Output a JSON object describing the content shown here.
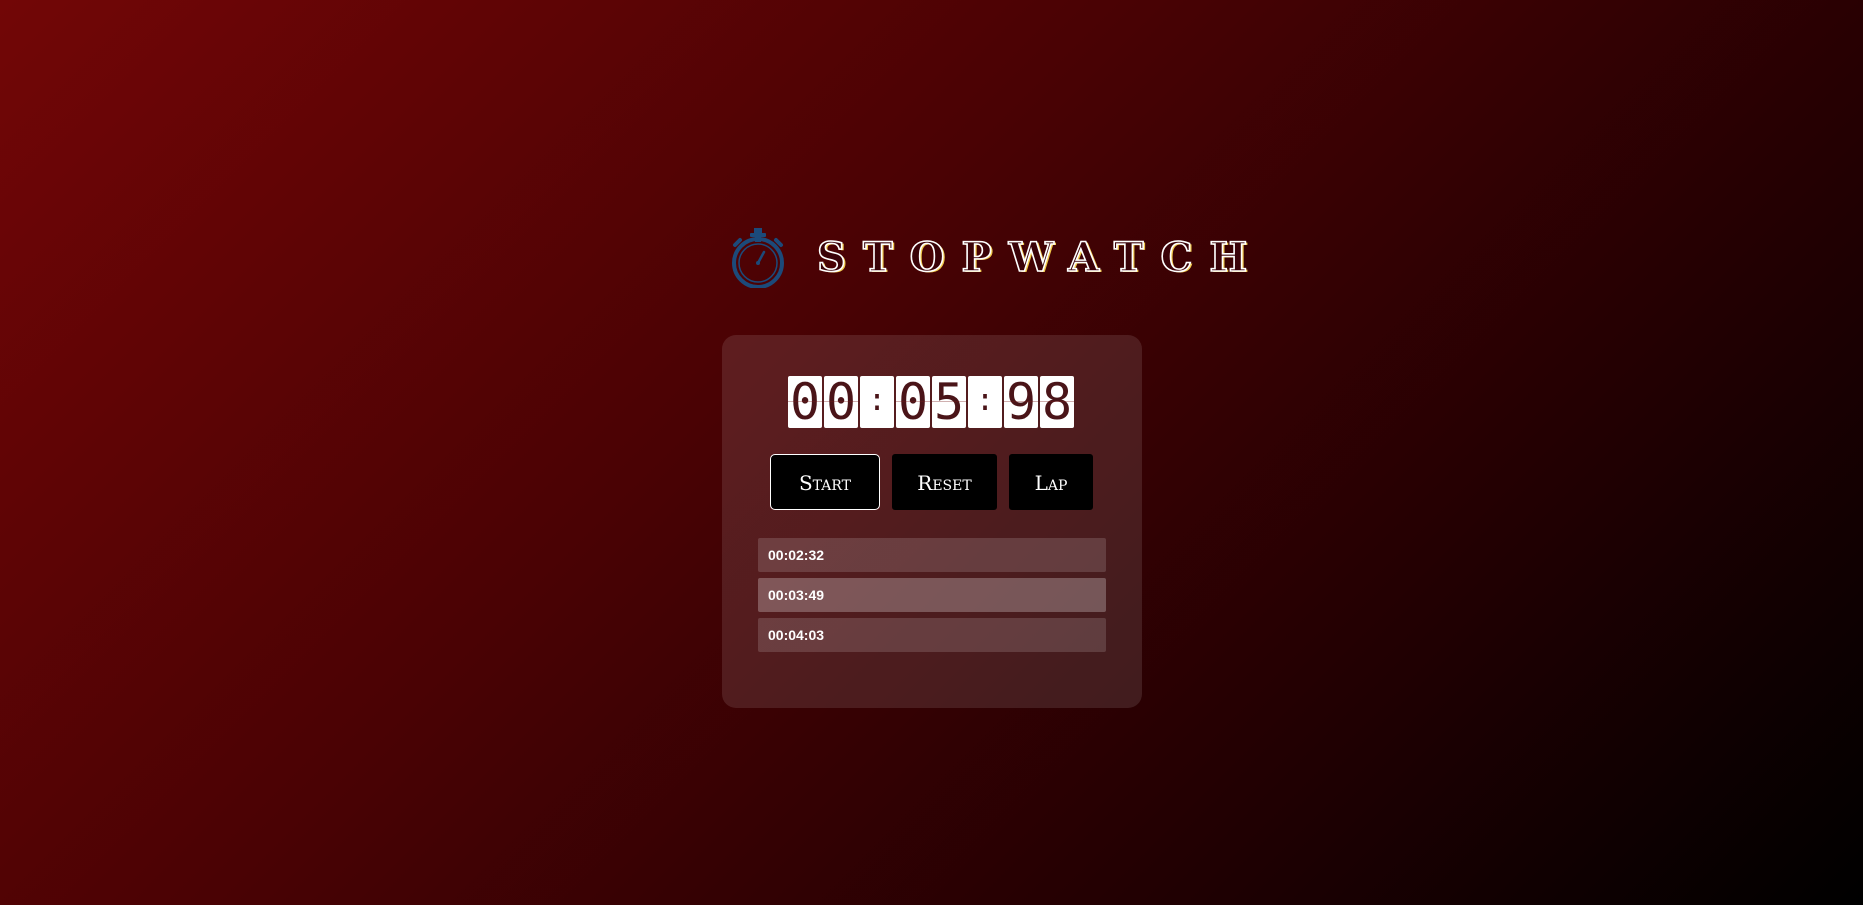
{
  "header": {
    "title": "STOPWATCH",
    "icon": "stopwatch-icon",
    "icon_color": "#1c4a7a"
  },
  "display": {
    "minutes": [
      "0",
      "0"
    ],
    "separator_1": ":",
    "seconds": [
      "0",
      "5"
    ],
    "separator_2": ":",
    "centiseconds": [
      "9",
      "8"
    ]
  },
  "controls": {
    "start_label": "Start",
    "reset_label": "Reset",
    "lap_label": "Lap"
  },
  "laps": [
    {
      "time": "00:02:32"
    },
    {
      "time": "00:03:49"
    },
    {
      "time": "00:04:03"
    }
  ],
  "colors": {
    "background_start": "#720606",
    "background_end": "#000000",
    "digit_text": "#4a1418",
    "button_bg": "#000000"
  }
}
